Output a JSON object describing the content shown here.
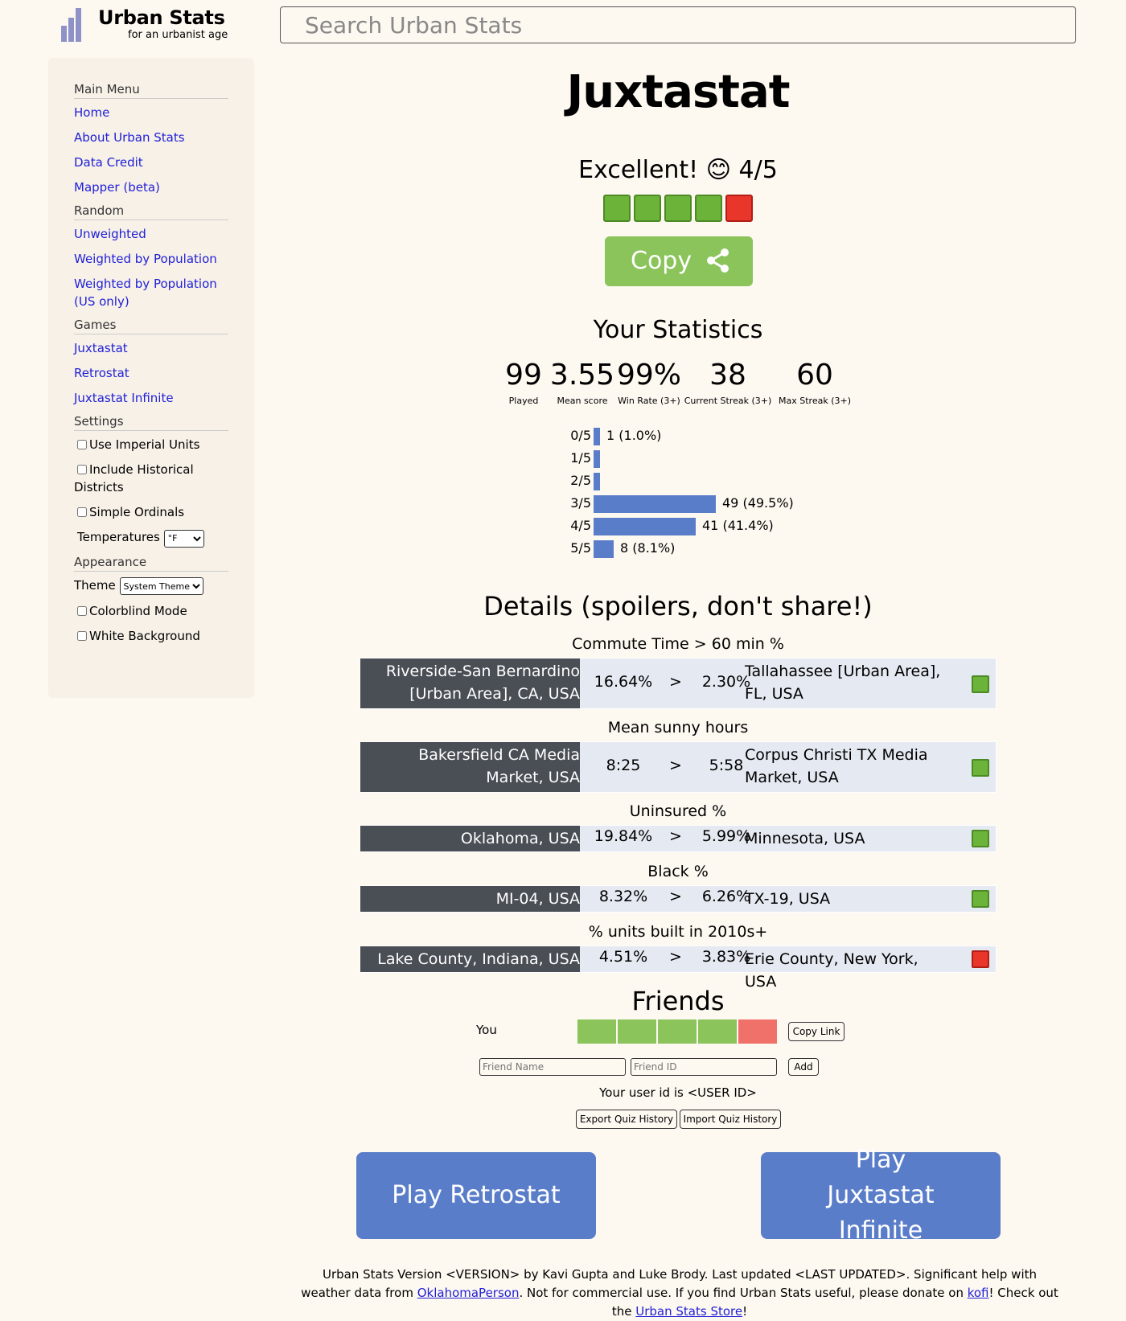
{
  "header": {
    "logo_title": "Urban Stats",
    "logo_subtitle": "for an urbanist age",
    "search_placeholder": "Search Urban Stats"
  },
  "sidebar": {
    "main_menu": {
      "title": "Main Menu",
      "items": [
        "Home",
        "About Urban Stats",
        "Data Credit",
        "Mapper (beta)"
      ]
    },
    "random": {
      "title": "Random",
      "items": [
        "Unweighted",
        "Weighted by Population",
        "Weighted by Population (US only)"
      ]
    },
    "games": {
      "title": "Games",
      "items": [
        "Juxtastat",
        "Retrostat",
        "Juxtastat Infinite"
      ]
    },
    "settings": {
      "title": "Settings",
      "checkboxes": [
        "Use Imperial Units",
        "Include Historical Districts",
        "Simple Ordinals"
      ],
      "temperature_label": "Temperatures",
      "temperature_value": "°F"
    },
    "appearance": {
      "title": "Appearance",
      "theme_label": "Theme",
      "theme_value": "System Theme",
      "checkboxes": [
        "Colorblind Mode",
        "White Background"
      ]
    }
  },
  "main": {
    "title": "Juxtastat",
    "result_text": "Excellent! 😊 4/5",
    "result_squares": [
      "correct",
      "correct",
      "correct",
      "correct",
      "wrong"
    ],
    "copy_label": "Copy",
    "stats_title": "Your Statistics",
    "stats": [
      {
        "value": "99",
        "label": "Played"
      },
      {
        "value": "3.55",
        "label": "Mean score"
      },
      {
        "value": "99%",
        "label": "Win Rate (3+)"
      },
      {
        "value": "38",
        "label": "Current Streak (3+)"
      },
      {
        "value": "60",
        "label": "Max Streak (3+)"
      }
    ],
    "histogram": [
      {
        "label": "0/5",
        "count": 1,
        "text": "1 (1.0%)"
      },
      {
        "label": "1/5",
        "count": 0,
        "text": ""
      },
      {
        "label": "2/5",
        "count": 0,
        "text": ""
      },
      {
        "label": "3/5",
        "count": 49,
        "text": "49 (49.5%)"
      },
      {
        "label": "4/5",
        "count": 41,
        "text": "41 (41.4%)"
      },
      {
        "label": "5/5",
        "count": 8,
        "text": "8 (8.1%)"
      }
    ],
    "details_title": "Details (spoilers, don't share!)",
    "questions": [
      {
        "stat": "Commute Time > 60 min %",
        "left": "Riverside-San Bernardino [Urban Area], CA, USA",
        "left_value": "16.64%",
        "comparator": ">",
        "right_value": "2.30%",
        "right": "Tallahassee [Urban Area], FL, USA",
        "result": "correct"
      },
      {
        "stat": "Mean sunny hours",
        "left": "Bakersfield CA Media Market, USA",
        "left_value": "8:25",
        "comparator": ">",
        "right_value": "5:58",
        "right": "Corpus Christi TX Media Market, USA",
        "result": "correct"
      },
      {
        "stat": "Uninsured %",
        "left": "Oklahoma, USA",
        "left_value": "19.84%",
        "comparator": ">",
        "right_value": "5.99%",
        "right": "Minnesota, USA",
        "result": "correct"
      },
      {
        "stat": "Black %",
        "left": "MI-04, USA",
        "left_value": "8.32%",
        "comparator": ">",
        "right_value": "6.26%",
        "right": "TX-19, USA",
        "result": "correct"
      },
      {
        "stat": "% units built in 2010s+",
        "left": "Lake County, Indiana, USA",
        "left_value": "4.51%",
        "comparator": ">",
        "right_value": "3.83%",
        "right": "Erie County, New York, USA",
        "result": "wrong"
      }
    ],
    "friends": {
      "title": "Friends",
      "you_label": "You",
      "you_results": [
        "correct",
        "correct",
        "correct",
        "correct",
        "wrong"
      ],
      "copy_link_label": "Copy Link",
      "friend_name_placeholder": "Friend Name",
      "friend_id_placeholder": "Friend ID",
      "add_label": "Add",
      "user_id_text": "Your user id is <USER ID>",
      "export_label": "Export Quiz History",
      "import_label": "Import Quiz History"
    },
    "play_retrostat_label": "Play Retrostat",
    "play_infinite_label": "Play Juxtastat Infinite"
  },
  "footer": {
    "text_1": "Urban Stats Version <VERSION> by Kavi Gupta and Luke Brody. Last updated <LAST UPDATED>. Significant help with weather data from ",
    "link_1": "OklahomaPerson",
    "text_2": ". Not for commercial use. If you find Urban Stats useful, please donate on ",
    "link_2": "kofi",
    "text_3": "! Check out the ",
    "link_3": "Urban Stats Store",
    "text_4": "!"
  },
  "colors": {
    "background": "#fdf8f0",
    "sidebar_bg": "#f7f1e8",
    "link": "#1f1fd6",
    "correct_green": "#6cb33a",
    "wrong_red": "#e8362b",
    "copy_button": "#8ac45a",
    "play_button": "#5a7dc9",
    "dark_cell": "#4a4e55",
    "light_cell": "#e5e9f1"
  }
}
